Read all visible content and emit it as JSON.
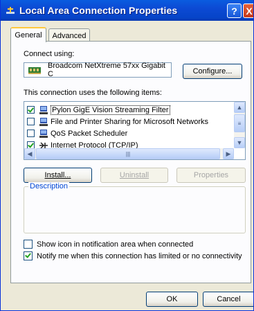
{
  "window": {
    "title": "Local Area Connection Properties",
    "help_label": "?",
    "close_label": "X"
  },
  "tabs": [
    {
      "label": "General",
      "active": true
    },
    {
      "label": "Advanced",
      "active": false
    }
  ],
  "connect_using": {
    "label": "Connect using:",
    "adapter_name": "Broadcom NetXtreme 57xx Gigabit C",
    "configure_label": "Configure..."
  },
  "items_section": {
    "label": "This connection uses the following items:",
    "items": [
      {
        "label": "Pylon GigE Vision Streaming Filter",
        "checked": true,
        "icon": "network-service-icon"
      },
      {
        "label": "File and Printer Sharing for Microsoft Networks",
        "checked": false,
        "icon": "network-service-icon"
      },
      {
        "label": "QoS Packet Scheduler",
        "checked": false,
        "icon": "network-service-icon"
      },
      {
        "label": "Internet Protocol (TCP/IP)",
        "checked": true,
        "icon": "protocol-icon"
      }
    ]
  },
  "actions": {
    "install": "Install...",
    "uninstall": "Uninstall",
    "properties": "Properties"
  },
  "description": {
    "legend": "Description",
    "text": ""
  },
  "options": [
    {
      "label": "Show icon in notification area when connected",
      "checked": false
    },
    {
      "label": "Notify me when this connection has limited or no connectivity",
      "checked": true
    }
  ],
  "footer": {
    "ok": "OK",
    "cancel": "Cancel"
  },
  "colors": {
    "titlebar": "#0a5ce0",
    "dialog_bg": "#ece9d8",
    "tab_highlight": "#ffc83c",
    "legend_text": "#0046d5"
  }
}
